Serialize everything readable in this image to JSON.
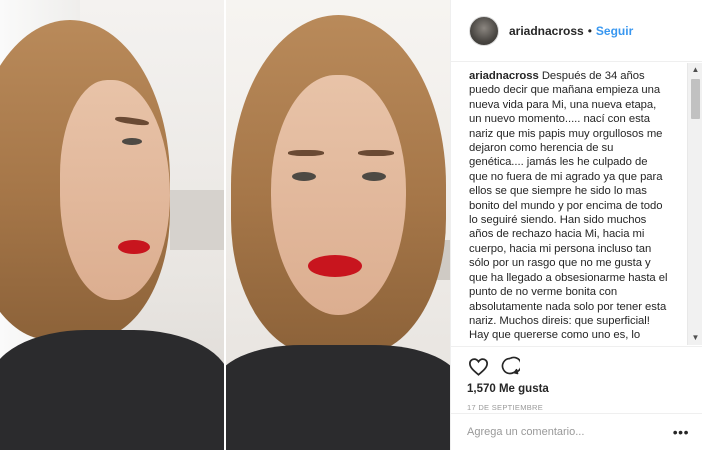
{
  "post": {
    "username": "ariadnacross",
    "separator": "•",
    "follow_label": "Seguir"
  },
  "caption": {
    "username": "ariadnacross",
    "text": "Después de 34 años puedo decir que mañana empieza una nueva vida para Mi, una nueva etapa, un nuevo momento..... nací con esta nariz que mis papis muy orgullosos me dejaron como herencia de su genética.... jamás les he culpado de que no fuera de mi agrado ya que para ellos se que siempre he sido lo mas bonito del mundo y por encima de todo lo seguiré siendo. Han sido muchos años de rechazo hacia Mi, hacia mi cuerpo, hacia mi persona incluso tan sólo por un rasgo que no me gusta y que ha llegado a obsesionarme hasta el punto de no verme bonita con absolutamente nada solo por tener esta nariz. Muchos direis: que superficial! Hay que quererse como uno es, lo importante no es el físico, etc etc y Sí, tenéis toda la razón del mundo ; pero yo no he sabido aceptarme así, por mas que lo he intentado, Llamadme débil"
  },
  "scrollbar": {
    "up": "▲",
    "down": "▼"
  },
  "engagement": {
    "likes": "1,570 Me gusta",
    "date": "17 DE SEPTIEMBRE"
  },
  "comment": {
    "placeholder": "Agrega un comentario...",
    "more": "•••"
  },
  "icons": {
    "like": "heart-icon",
    "comment": "comment-icon",
    "more": "more-options-icon"
  },
  "colors": {
    "link": "#3897f0",
    "text": "#262626",
    "muted": "#999999"
  }
}
